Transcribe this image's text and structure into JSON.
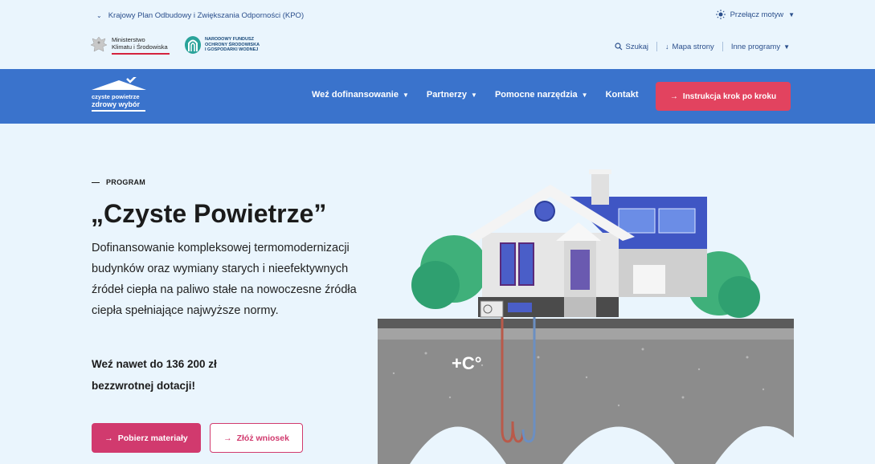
{
  "topbar": {
    "kpo_label": "Krajowy Plan Odbudowy i Zwiększania Odporności (KPO)",
    "theme_label": "Przełącz motyw",
    "ministry_line1": "Ministerstwo",
    "ministry_line2": "Klimatu i Środowiska",
    "nfosigw_line1": "NARODOWY FUNDUSZ",
    "nfosigw_line2": "OCHRONY ŚRODOWISKA",
    "nfosigw_line3": "I GOSPODARKI WODNEJ",
    "search_label": "Szukaj",
    "sitemap_label": "Mapa strony",
    "other_label": "Inne programy"
  },
  "nav": {
    "brand_line1": "czyste powietrze",
    "brand_line2": "zdrowy wybór",
    "items": [
      {
        "label": "Weź dofinansowanie"
      },
      {
        "label": "Partnerzy"
      },
      {
        "label": "Pomocne narzędzia"
      },
      {
        "label": "Kontakt"
      }
    ],
    "cta_label": "Instrukcja krok po kroku"
  },
  "hero": {
    "eyebrow": "PROGRAM",
    "title": "„Czyste Powietrze”",
    "description": "Dofinansowanie kompleksowej termomodernizacji budynków oraz wymiany starych i nieefektywnych źródeł ciepła na paliwo stałe na nowoczesne źródła ciepła spełniające najwyższe normy.",
    "amount_line1": "Weź nawet do 136 200 zł",
    "amount_line2": "bezzwrotnej dotacji!",
    "primary_button": "Pobierz materiały",
    "secondary_button": "Złóż wniosek",
    "heat_label": "+C°"
  },
  "colors": {
    "accent_blue": "#3a73cc",
    "accent_pink": "#d13a6e",
    "cta_red": "#e2435f",
    "bg_light": "#eaf5fd"
  }
}
